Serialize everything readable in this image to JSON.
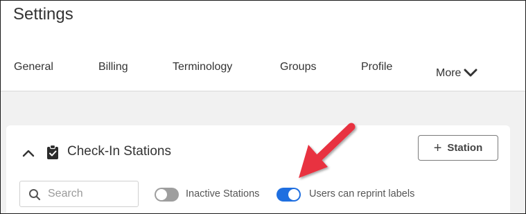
{
  "page": {
    "title": "Settings"
  },
  "tabs": [
    {
      "label": "General"
    },
    {
      "label": "Billing"
    },
    {
      "label": "Terminology"
    },
    {
      "label": "Groups"
    },
    {
      "label": "Profile"
    },
    {
      "label": "More"
    }
  ],
  "section": {
    "title": "Check-In Stations",
    "add_button_label": "Station",
    "search_placeholder": "Search",
    "toggles": [
      {
        "label": "Inactive Stations",
        "on": false
      },
      {
        "label": "Users can reprint labels",
        "on": true
      }
    ]
  },
  "colors": {
    "toggle_on": "#1f6fe0",
    "toggle_off": "#9e9e9e",
    "annotation_arrow": "#e8303f",
    "content_background": "#f1f1f1"
  },
  "icons": [
    "chevron-down-icon",
    "chevron-up-icon",
    "clipboard-check-icon",
    "plus-icon",
    "search-icon"
  ]
}
